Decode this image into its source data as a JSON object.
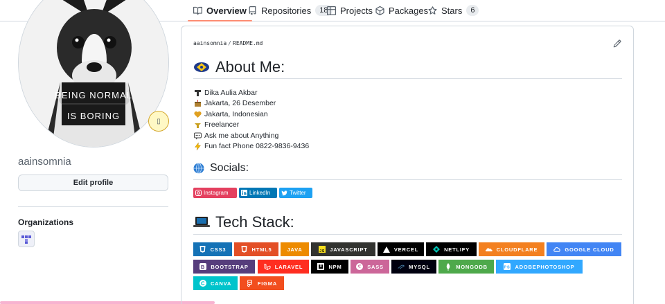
{
  "tabs": [
    {
      "label": "Overview",
      "icon": "book-icon",
      "active": true
    },
    {
      "label": "Repositories",
      "icon": "repo-icon",
      "count": "18"
    },
    {
      "label": "Projects",
      "icon": "table-icon"
    },
    {
      "label": "Packages",
      "icon": "package-icon"
    },
    {
      "label": "Stars",
      "icon": "star-icon",
      "count": "6"
    }
  ],
  "profile": {
    "sign_line1": "BEING NORMAL",
    "sign_line2": "IS BORING",
    "status_emoji": "▯",
    "username": "aainsomnia",
    "edit_label": "Edit profile",
    "organizations_title": "Organizations"
  },
  "readme": {
    "path_owner": "aainsomnia",
    "path_sep": "/",
    "path_file": "README.md",
    "about_title": "About Me:",
    "about_items": [
      {
        "icon": "person-emoji",
        "text": "Dika Aulia Akbar"
      },
      {
        "icon": "birthday-emoji",
        "text": "Jakarta, 26 Desember"
      },
      {
        "icon": "heart-emoji",
        "text": "Jakarta, Indonesian"
      },
      {
        "icon": "freelancer-emoji",
        "text": "Freelancer"
      },
      {
        "icon": "speech-bubble-emoji",
        "text": "Ask me about Anything"
      },
      {
        "icon": "zap-emoji",
        "text": "Fun fact Phone 0822-9836-9436"
      }
    ],
    "socials_title": "Socials:",
    "socials": [
      {
        "label": "Instagram",
        "color": "#E4405F"
      },
      {
        "label": "LinkedIn",
        "color": "#0077B5"
      },
      {
        "label": "Twitter",
        "color": "#1DA1F2"
      }
    ],
    "tech_title": "Tech Stack:",
    "tech": [
      {
        "label": "css3",
        "color": "#1572B6"
      },
      {
        "label": "html5",
        "color": "#E34F26"
      },
      {
        "label": "java",
        "color": "#ED8B00"
      },
      {
        "label": "javascript",
        "color": "#323330"
      },
      {
        "label": "vercel",
        "color": "#000000"
      },
      {
        "label": "netlify",
        "color": "#000000"
      },
      {
        "label": "cloudflare",
        "color": "#F38020"
      },
      {
        "label": "google cloud",
        "color": "#4285F4"
      },
      {
        "label": "bootstrap",
        "color": "#563D7C"
      },
      {
        "label": "laravel",
        "color": "#FF2D20"
      },
      {
        "label": "npm",
        "color": "#000000"
      },
      {
        "label": "sass",
        "color": "#CC6699"
      },
      {
        "label": "mysql",
        "color": "#00000F"
      },
      {
        "label": "mongodb",
        "color": "#4EA94B"
      },
      {
        "label": "adobephotoshop",
        "color": "#31A8FF"
      },
      {
        "label": "canva",
        "color": "#00C4CC"
      },
      {
        "label": "figma",
        "color": "#F24E1E"
      }
    ]
  }
}
